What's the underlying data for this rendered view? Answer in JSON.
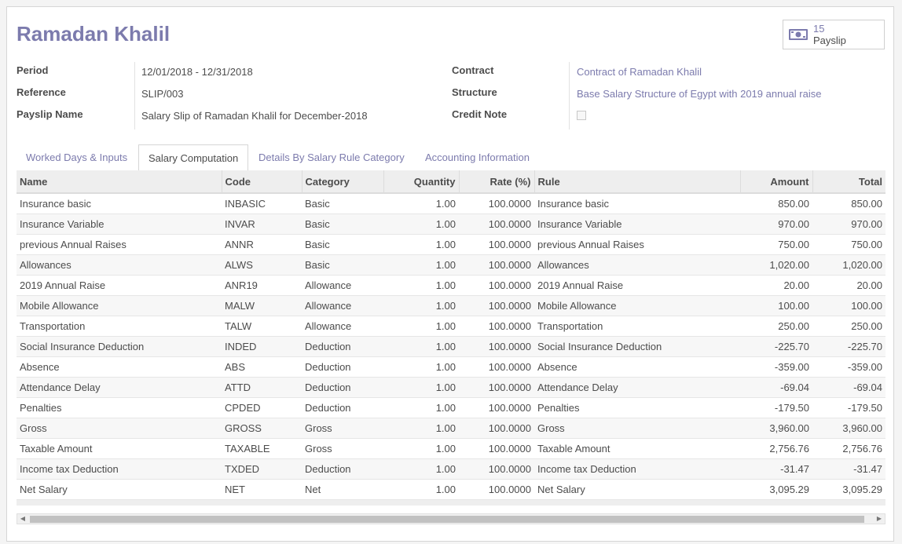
{
  "employee_name": "Ramadan Khalil",
  "smart_button": {
    "count": "15",
    "label": "Payslip",
    "icon": "money-icon"
  },
  "fields": {
    "period_label": "Period",
    "period_value": "12/01/2018 - 12/31/2018",
    "reference_label": "Reference",
    "reference_value": "SLIP/003",
    "payslip_name_label": "Payslip Name",
    "payslip_name_value": "Salary Slip of Ramadan Khalil for December-2018",
    "contract_label": "Contract",
    "contract_value": "Contract of Ramadan Khalil",
    "structure_label": "Structure",
    "structure_value": "Base Salary Structure of Egypt with 2019 annual raise",
    "credit_note_label": "Credit Note",
    "credit_note_checked": false
  },
  "tabs": [
    {
      "label": "Worked Days & Inputs",
      "active": false
    },
    {
      "label": "Salary Computation",
      "active": true
    },
    {
      "label": "Details By Salary Rule Category",
      "active": false
    },
    {
      "label": "Accounting Information",
      "active": false
    }
  ],
  "columns": [
    "Name",
    "Code",
    "Category",
    "Quantity",
    "Rate (%)",
    "Rule",
    "Amount",
    "Total"
  ],
  "rows": [
    [
      "Insurance basic",
      "INBASIC",
      "Basic",
      "1.00",
      "100.0000",
      "Insurance basic",
      "850.00",
      "850.00"
    ],
    [
      "Insurance Variable",
      "INVAR",
      "Basic",
      "1.00",
      "100.0000",
      "Insurance Variable",
      "970.00",
      "970.00"
    ],
    [
      "previous Annual Raises",
      "ANNR",
      "Basic",
      "1.00",
      "100.0000",
      "previous Annual Raises",
      "750.00",
      "750.00"
    ],
    [
      "Allowances",
      "ALWS",
      "Basic",
      "1.00",
      "100.0000",
      "Allowances",
      "1,020.00",
      "1,020.00"
    ],
    [
      "2019 Annual Raise",
      "ANR19",
      "Allowance",
      "1.00",
      "100.0000",
      "2019 Annual Raise",
      "20.00",
      "20.00"
    ],
    [
      "Mobile Allowance",
      "MALW",
      "Allowance",
      "1.00",
      "100.0000",
      "Mobile Allowance",
      "100.00",
      "100.00"
    ],
    [
      "Transportation",
      "TALW",
      "Allowance",
      "1.00",
      "100.0000",
      "Transportation",
      "250.00",
      "250.00"
    ],
    [
      "Social Insurance Deduction",
      "INDED",
      "Deduction",
      "1.00",
      "100.0000",
      "Social Insurance Deduction",
      "-225.70",
      "-225.70"
    ],
    [
      "Absence",
      "ABS",
      "Deduction",
      "1.00",
      "100.0000",
      "Absence",
      "-359.00",
      "-359.00"
    ],
    [
      "Attendance Delay",
      "ATTD",
      "Deduction",
      "1.00",
      "100.0000",
      "Attendance Delay",
      "-69.04",
      "-69.04"
    ],
    [
      "Penalties",
      "CPDED",
      "Deduction",
      "1.00",
      "100.0000",
      "Penalties",
      "-179.50",
      "-179.50"
    ],
    [
      "Gross",
      "GROSS",
      "Gross",
      "1.00",
      "100.0000",
      "Gross",
      "3,960.00",
      "3,960.00"
    ],
    [
      "Taxable Amount",
      "TAXABLE",
      "Gross",
      "1.00",
      "100.0000",
      "Taxable Amount",
      "2,756.76",
      "2,756.76"
    ],
    [
      "Income tax Deduction",
      "TXDED",
      "Deduction",
      "1.00",
      "100.0000",
      "Income tax Deduction",
      "-31.47",
      "-31.47"
    ],
    [
      "Net Salary",
      "NET",
      "Net",
      "1.00",
      "100.0000",
      "Net Salary",
      "3,095.29",
      "3,095.29"
    ]
  ],
  "colors": {
    "accent": "#7c7bad",
    "text": "#4c4c4c",
    "header_bg": "#eeeeee"
  }
}
